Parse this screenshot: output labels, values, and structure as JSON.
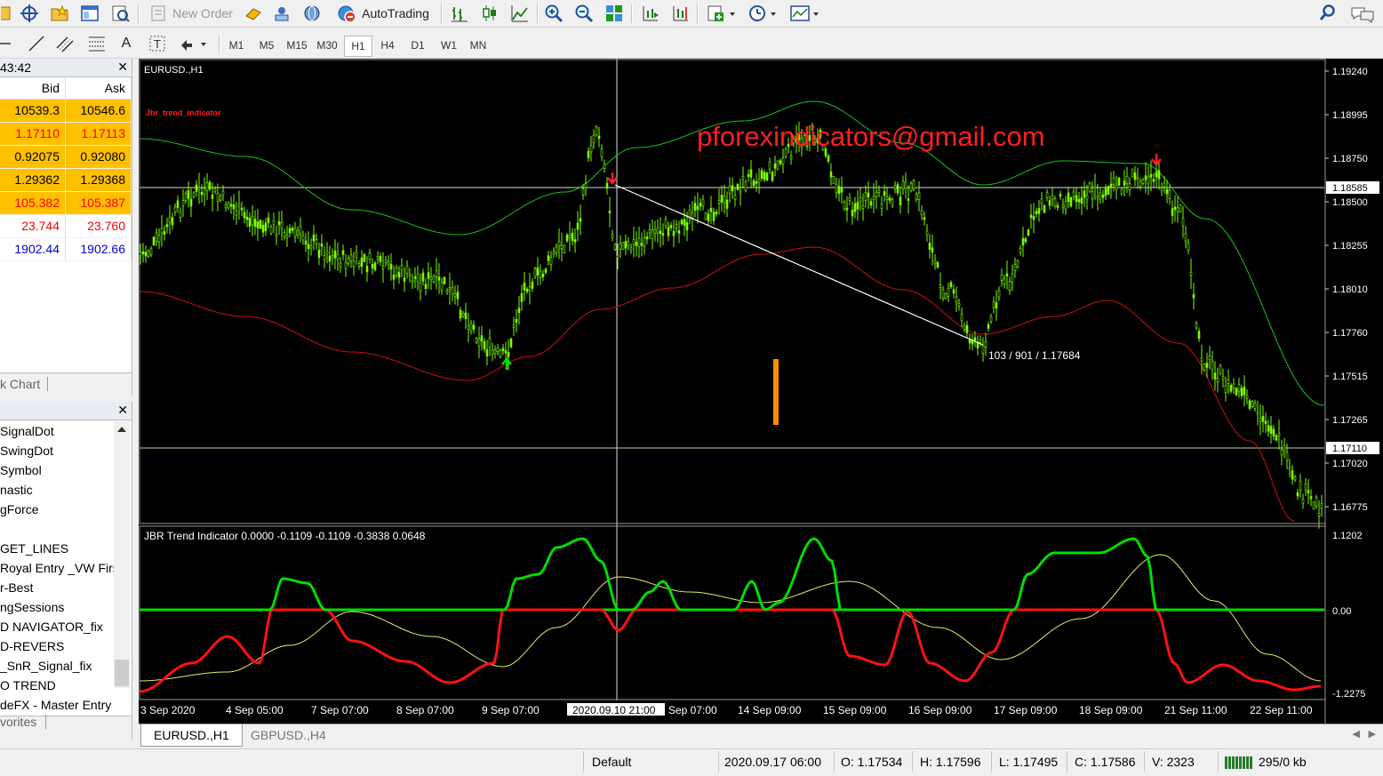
{
  "toolbar": {
    "new_order": "New Order",
    "autotrading": "AutoTrading",
    "timeframes": [
      "M1",
      "M5",
      "M15",
      "M30",
      "H1",
      "H4",
      "D1",
      "W1",
      "MN"
    ],
    "active_timeframe": "H1"
  },
  "market_watch": {
    "time": "43:42",
    "col_bid": "Bid",
    "col_ask": "Ask",
    "rows": [
      {
        "bid": "10539.3",
        "ask": "10546.6",
        "bg": "#ffc000",
        "color": "#000000"
      },
      {
        "bid": "1.17110",
        "ask": "1.17113",
        "bg": "#ffc000",
        "color": "#ff0000"
      },
      {
        "bid": "0.92075",
        "ask": "0.92080",
        "bg": "#ffc000",
        "color": "#000000"
      },
      {
        "bid": "1.29362",
        "ask": "1.29368",
        "bg": "#ffc000",
        "color": "#000000"
      },
      {
        "bid": "105.382",
        "ask": "105.387",
        "bg": "#ffc000",
        "color": "#ff0000"
      },
      {
        "bid": "23.744",
        "ask": "23.760",
        "bg": "#ffffff",
        "color": "#ff0000"
      },
      {
        "bid": "1902.44",
        "ask": "1902.66",
        "bg": "#ffffff",
        "color": "#0000cc"
      }
    ],
    "tab": "k Chart"
  },
  "navigator": {
    "items": [
      "SignalDot",
      "SwingDot",
      "Symbol",
      "nastic",
      "gForce",
      "",
      "GET_LINES",
      "Royal Entry _VW Firs",
      "r-Best",
      "ngSessions",
      "D NAVIGATOR_fix",
      "D-REVERS",
      "_SnR_Signal_fix",
      "O TREND",
      "deFX - Master Entry"
    ],
    "tab": "vorites"
  },
  "chart": {
    "symbol_label": "EURUSD.,H1",
    "indicator_name": "Jbr_trend_indicator",
    "watermark": "pforexindicators@gmail.com",
    "crosshair_readout": "103 / 901 / 1.17684",
    "price_labels": [
      "1.19240",
      "1.18995",
      "1.18750",
      "1.18500",
      "1.18255",
      "1.18010",
      "1.17760",
      "1.17515",
      "1.17265",
      "1.17020",
      "1.16775"
    ],
    "current_price_label": "1.17110",
    "hline_price_label": "1.18585",
    "subwindow_title": "JBR Trend Indicator 0.0000 -0.1109 -0.1109 -0.3838 0.0648",
    "sub_labels": [
      "1.1202",
      "0.00",
      "-1.2275"
    ],
    "time_labels": [
      "3 Sep 2020",
      "4 Sep 05:00",
      "7 Sep 07:00",
      "8 Sep 07:00",
      "9 Sep 07:00",
      "2020.09.10 21:00",
      "Sep 07:00",
      "14 Sep 09:00",
      "15 Sep 09:00",
      "16 Sep 09:00",
      "17 Sep 09:00",
      "18 Sep 09:00",
      "21 Sep 11:00",
      "22 Sep 11:00"
    ],
    "colors": {
      "candles": "#7cfc00",
      "upper_band": "#1fbf1f",
      "lower_band": "#cc1010",
      "signal_up": "#00dd00",
      "signal_down": "#ff1111",
      "slow_line": "#e8e86a",
      "watermark": "#ff2020"
    }
  },
  "tabs": [
    "EURUSD.,H1",
    "GBPUSD.,H4"
  ],
  "status": {
    "profile": "Default",
    "datetime": "2020.09.17 06:00",
    "open": "O: 1.17534",
    "high": "H: 1.17596",
    "low": "L: 1.17495",
    "close": "C: 1.17586",
    "volume": "V: 2323",
    "traffic": "295/0 kb"
  }
}
